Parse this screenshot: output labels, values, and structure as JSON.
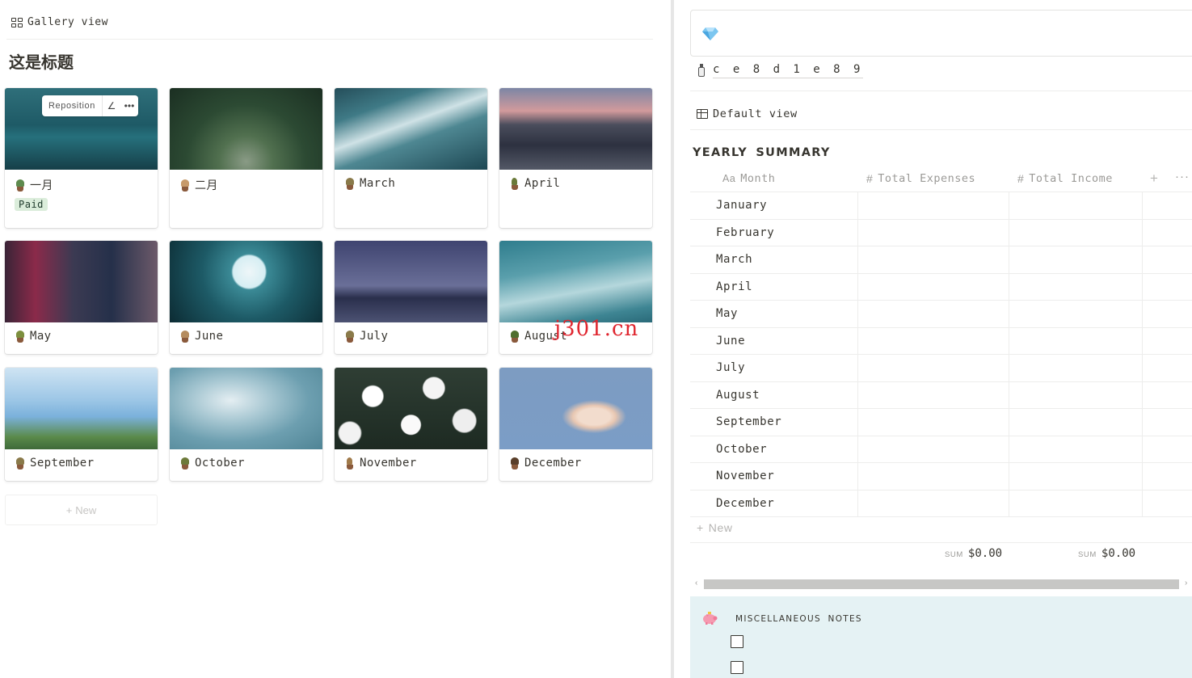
{
  "gallery": {
    "view_label": "Gallery view",
    "title": "这是标题",
    "reposition_label": "Reposition",
    "new_label": "New",
    "cards": [
      {
        "name": "一月",
        "tag": "Paid"
      },
      {
        "name": "二月"
      },
      {
        "name": "March"
      },
      {
        "name": "April"
      },
      {
        "name": "May"
      },
      {
        "name": "June"
      },
      {
        "name": "July"
      },
      {
        "name": "August"
      },
      {
        "name": "September"
      },
      {
        "name": "October"
      },
      {
        "name": "November"
      },
      {
        "name": "December"
      }
    ]
  },
  "watermark": "j301.cn",
  "right": {
    "encoded_title": "c e 8 d 1 e 8 9",
    "table_view_label": "Default view",
    "section_title": "YEARLY SUMMARY",
    "columns": {
      "month_prefix": "Aa",
      "month": "Month",
      "expenses_prefix": "#",
      "expenses": "Total Expenses",
      "income_prefix": "#",
      "income": "Total Income",
      "add": "+",
      "more": "···"
    },
    "rows": [
      "January",
      "February",
      "March",
      "April",
      "May",
      "June",
      "July",
      "August",
      "September",
      "October",
      "November",
      "December"
    ],
    "new_label": "New",
    "sum_label": "SUM",
    "sum_expenses": "$0.00",
    "sum_income": "$0.00",
    "notes_title": "MISCELLANEOUS NOTES"
  },
  "colors": {
    "tag_paid_bg": "#dbeddb",
    "notes_bg": "#e5f2f4",
    "watermark": "#e0262f"
  }
}
